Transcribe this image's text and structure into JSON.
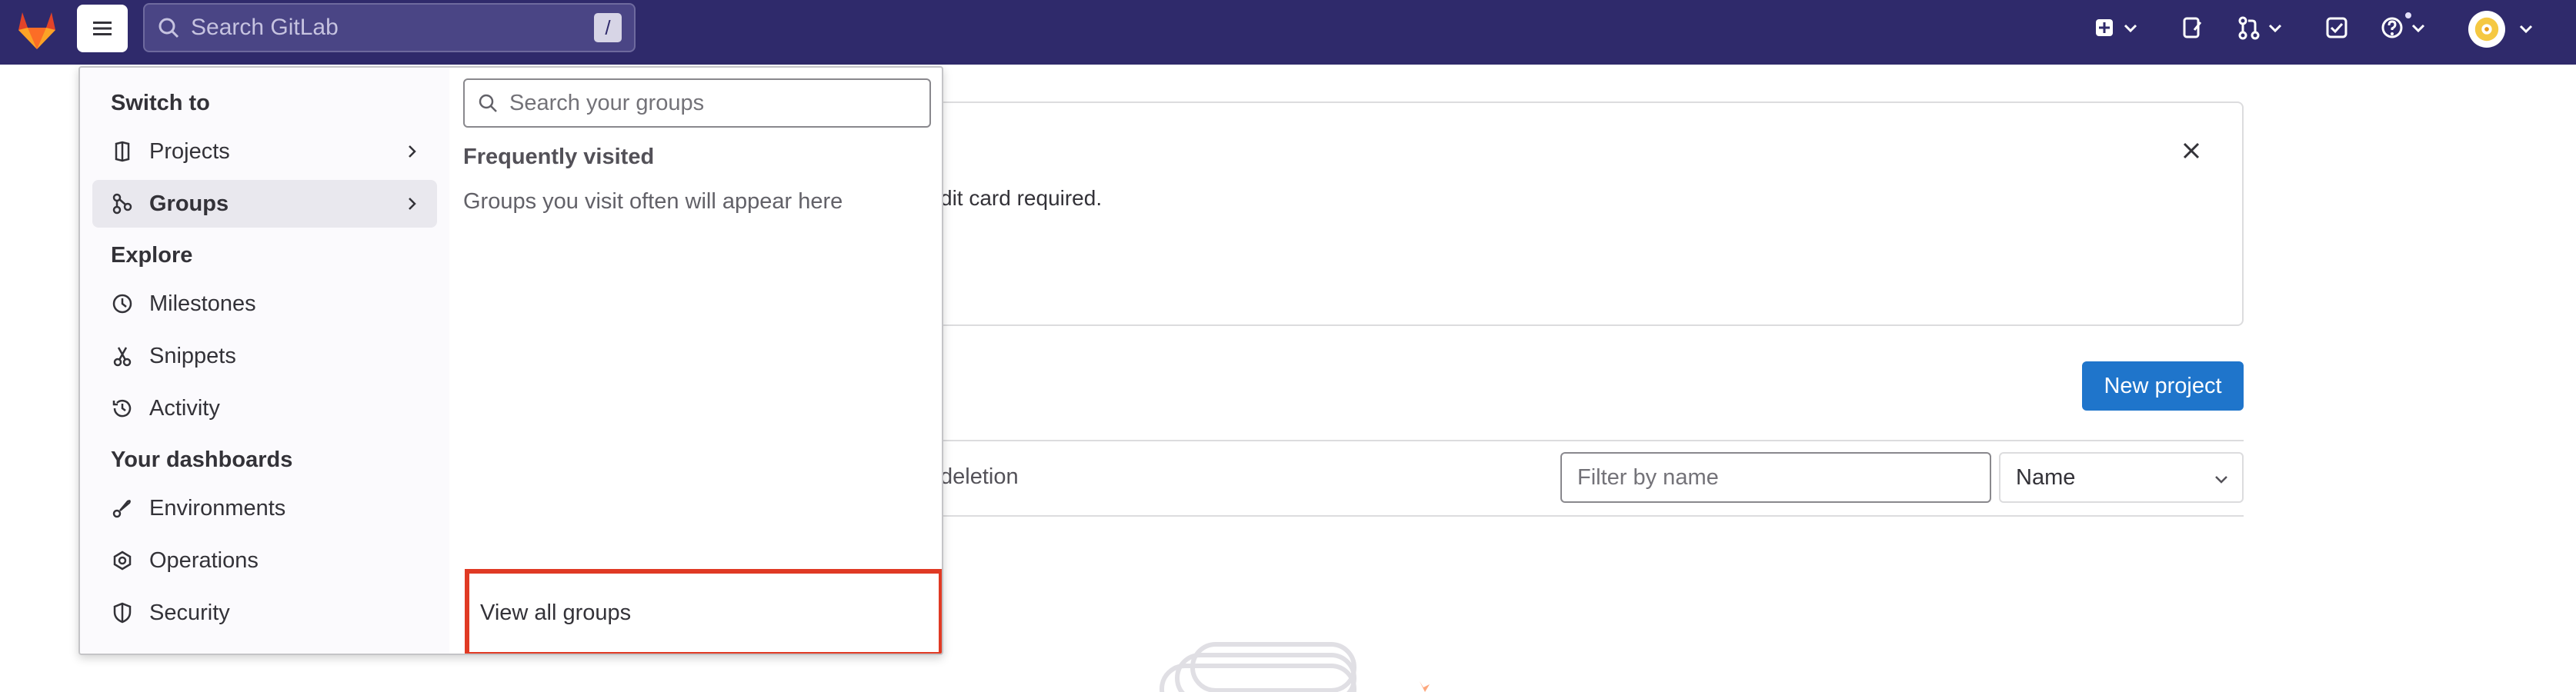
{
  "topbar": {
    "search_placeholder": "Search GitLab",
    "search_shortcut": "/",
    "icons": [
      "gitlab-logo",
      "menu-icon",
      "search-icon",
      "plus-square-icon",
      "merge-request-icon",
      "todo-icon",
      "help-icon",
      "avatar"
    ]
  },
  "background": {
    "alert_text": "dit card required.",
    "new_project_label": "New project",
    "tab_partial": "deletion",
    "filter_placeholder": "Filter by name",
    "sort_value": "Name"
  },
  "menu": {
    "switch_to_title": "Switch to",
    "items_switch": [
      {
        "label": "Projects",
        "icon": "project-icon"
      },
      {
        "label": "Groups",
        "icon": "group-icon"
      }
    ],
    "explore_title": "Explore",
    "items_explore": [
      {
        "label": "Milestones",
        "icon": "clock-icon"
      },
      {
        "label": "Snippets",
        "icon": "snippet-icon"
      },
      {
        "label": "Activity",
        "icon": "history-icon"
      }
    ],
    "dashboards_title": "Your dashboards",
    "items_dashboards": [
      {
        "label": "Environments",
        "icon": "rocket-icon"
      },
      {
        "label": "Operations",
        "icon": "cloud-gear-icon"
      },
      {
        "label": "Security",
        "icon": "shield-icon"
      }
    ],
    "groups_search_placeholder": "Search your groups",
    "frequently_visited_title": "Frequently visited",
    "frequently_visited_empty": "Groups you visit often will appear here",
    "view_all_label": "View all groups"
  },
  "colors": {
    "topbar_bg": "#2f2a6b",
    "primary_button": "#1f75cb",
    "highlight_box": "#e03a24"
  }
}
